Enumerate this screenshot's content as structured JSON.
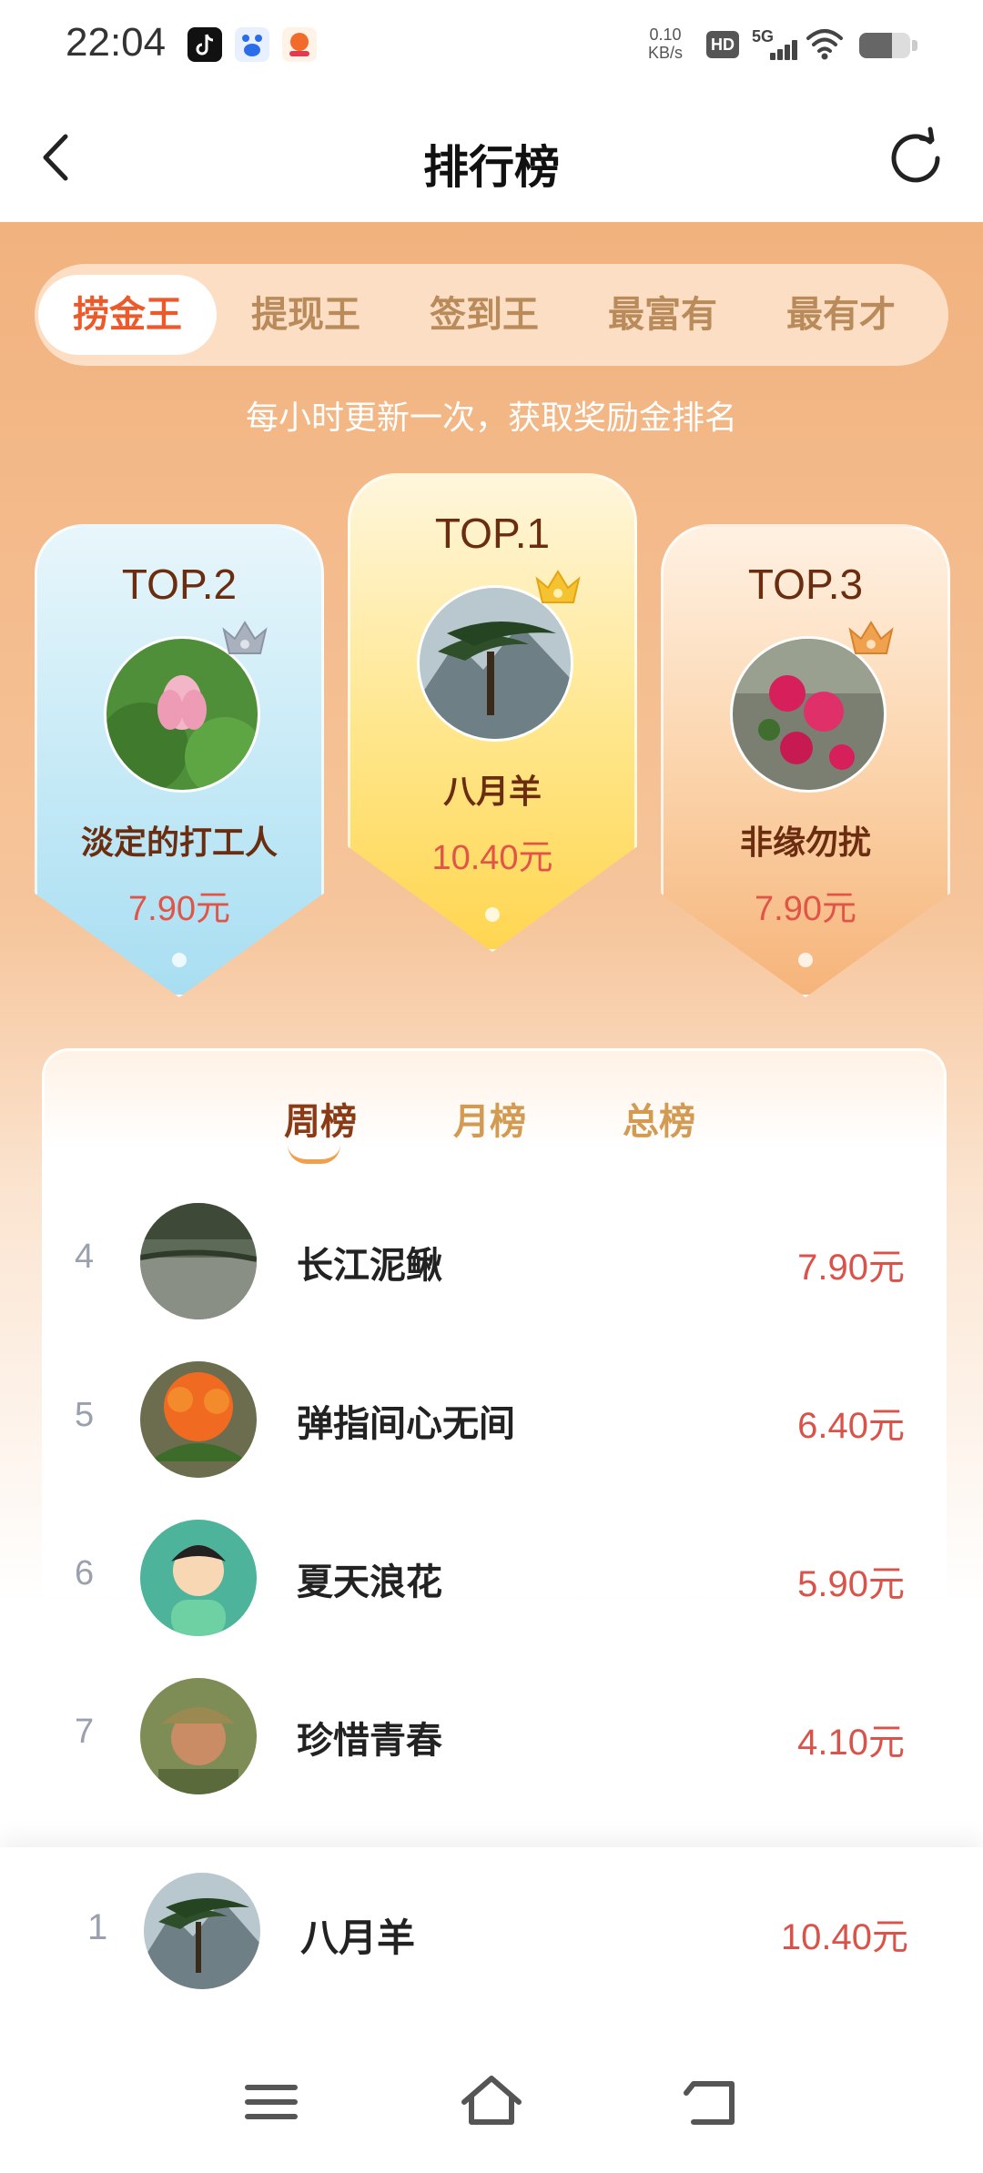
{
  "status_bar": {
    "time": "22:04",
    "net_speed_value": "0.10",
    "net_speed_unit": "KB/s",
    "hd": "HD",
    "network": "5G",
    "signal_bars": 4,
    "battery_level": 0.65,
    "notification_icons": [
      "tiktok-icon",
      "baidu-icon",
      "app-icon"
    ]
  },
  "header": {
    "title": "排行榜"
  },
  "category_tabs": [
    {
      "label": "捞金王",
      "active": true
    },
    {
      "label": "提现王",
      "active": false
    },
    {
      "label": "签到王",
      "active": false
    },
    {
      "label": "最富有",
      "active": false
    },
    {
      "label": "最有才",
      "active": false
    }
  ],
  "subtitle": "每小时更新一次，获取奖励金排名",
  "podium": {
    "first": {
      "label": "TOP.1",
      "name": "八月羊",
      "amount": "10.40元",
      "crown": "gold-crown-icon"
    },
    "second": {
      "label": "TOP.2",
      "name": "淡定的打工人",
      "amount": "7.90元",
      "crown": "silver-crown-icon"
    },
    "third": {
      "label": "TOP.3",
      "name": "非缘勿扰",
      "amount": "7.90元",
      "crown": "bronze-crown-icon"
    }
  },
  "period_tabs": [
    {
      "label": "周榜",
      "active": true
    },
    {
      "label": "月榜",
      "active": false
    },
    {
      "label": "总榜",
      "active": false
    }
  ],
  "list": [
    {
      "rank": "4",
      "name": "长江泥鳅",
      "amount": "7.90元"
    },
    {
      "rank": "5",
      "name": "弹指间心无间",
      "amount": "6.40元"
    },
    {
      "rank": "6",
      "name": "夏天浪花",
      "amount": "5.90元"
    },
    {
      "rank": "7",
      "name": "珍惜青春",
      "amount": "4.10元"
    }
  ],
  "my_rank": {
    "rank": "1",
    "name": "八月羊",
    "amount": "10.40元"
  },
  "colors": {
    "accent": "#ec5a2c",
    "amount": "#d9534a",
    "hero_top": "#f1b27e"
  }
}
